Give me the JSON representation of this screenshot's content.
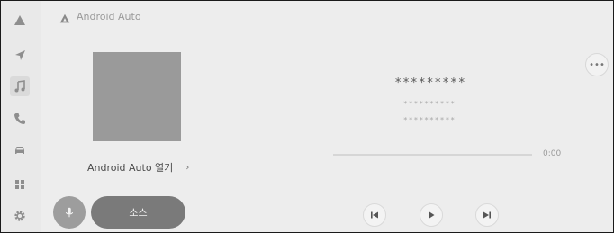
{
  "header": {
    "title": "Android Auto"
  },
  "sidebar": {
    "items": [
      {
        "icon": "android-auto-icon",
        "active": false
      },
      {
        "icon": "navigation-arrow-icon",
        "active": false
      },
      {
        "icon": "music-note-icon",
        "active": true
      },
      {
        "icon": "phone-icon",
        "active": false
      },
      {
        "icon": "car-icon",
        "active": false
      },
      {
        "icon": "apps-grid-icon",
        "active": false
      },
      {
        "icon": "settings-gear-icon",
        "active": false
      }
    ]
  },
  "media": {
    "open_label": "Android Auto 열기",
    "source_label": "소스",
    "track_title": "*********",
    "track_line_1": "**********",
    "track_line_2": "**********",
    "time": "0:00",
    "progress": 0
  }
}
